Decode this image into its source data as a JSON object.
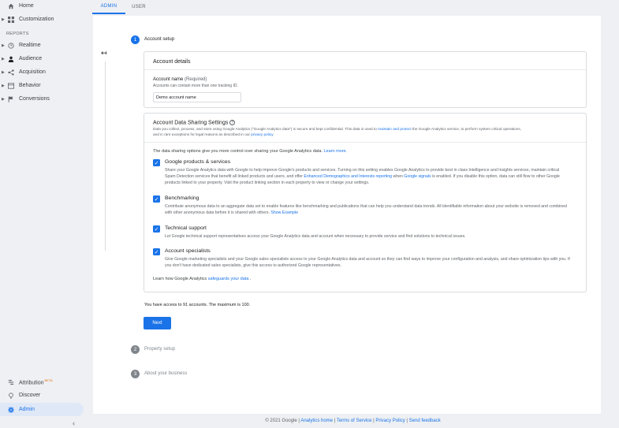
{
  "sidebar": {
    "home": "Home",
    "customization": "Customization",
    "reports_heading": "REPORTS",
    "realtime": "Realtime",
    "audience": "Audience",
    "acquisition": "Acquisition",
    "behavior": "Behavior",
    "conversions": "Conversions",
    "attribution": "Attribution",
    "attribution_badge": "BETA",
    "discover": "Discover",
    "admin": "Admin"
  },
  "tabs": {
    "admin": "ADMIN",
    "user": "USER"
  },
  "steps": {
    "s1_num": "1",
    "s1_label": "Account setup",
    "s2_num": "2",
    "s2_label": "Property setup",
    "s3_num": "3",
    "s3_label": "About your business"
  },
  "account_details": {
    "title": "Account details",
    "name_label": "Account name",
    "required": "(Required)",
    "hint": "Accounts can contain more than one tracking ID.",
    "value": "Demo account name"
  },
  "sharing": {
    "title": "Account Data Sharing Settings",
    "intro_1": "Data you collect, process, and store using Google Analytics (\"Google Analytics data\") is secure and kept confidential. This data is used to ",
    "intro_link": "maintain and protect",
    "intro_2": " the Google Analytics service, to perform system critical operations,",
    "intro_3": "and in rare exceptions for legal reasons as described in our ",
    "privacy_link": "privacy policy",
    "lead": "The data sharing options give you more control over sharing your Google Analytics data. ",
    "learn_more": "Learn more.",
    "options": [
      {
        "title": "Google products & services",
        "desc_1": "Share your Google Analytics data with Google to help improve Google's products and services. Turning on this setting enables Google Analytics to provide best in class Intelligence and Insights services, maintain critical Spam Detection services that benefit all linked products and users, and offer ",
        "desc_link1": "Enhanced Demographics and Interests reporting",
        "desc_mid": " when ",
        "desc_link2": "Google signals",
        "desc_2": " is enabled. If you disable this option, data can still flow to other Google products linked to your property. Visit the product linking section in each property to view or change your settings."
      },
      {
        "title": "Benchmarking",
        "desc_1": "Contribute anonymous data to an aggregate data set to enable features like benchmarking and publications that can help you understand data trends. All identifiable information about your website is removed and combined with other anonymous data before it is shared with others. ",
        "desc_link1": "Show Example"
      },
      {
        "title": "Technical support",
        "desc_1": "Let Google technical support representatives access your Google Analytics data and account when necessary to provide service and find solutions to technical issues."
      },
      {
        "title": "Account specialists",
        "desc_1": "Give Google marketing specialists and your Google sales specialists access to your Google Analytics data and account so they can find ways to improve your configuration and analysis, and share optimization tips with you. If you don't have dedicated sales specialists, give this access to authorized Google representatives."
      }
    ],
    "safeguards_1": "Learn how Google Analytics ",
    "safeguards_link": "safeguards your data",
    "safeguards_2": " ."
  },
  "access_note": "You have access to 91 accounts. The maximum is 100.",
  "next_label": "Next",
  "footer": {
    "copyright": "© 2021 Google | ",
    "home": "Analytics home",
    "sep1": " | ",
    "terms": "Terms of Service",
    "sep2": " | ",
    "privacy": "Privacy Policy",
    "sep3": " | ",
    "feedback": "Send feedback"
  },
  "colors": {
    "accent": "#1a73e8",
    "background": "#eef0f3",
    "active_nav": "#dfe8f7"
  }
}
